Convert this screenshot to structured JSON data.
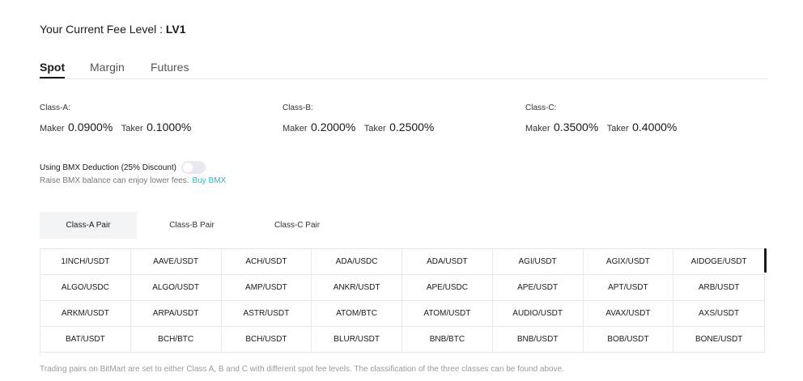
{
  "fee_level": {
    "label": "Your Current Fee Level : ",
    "level": "LV1"
  },
  "tabs": [
    {
      "label": "Spot",
      "active": true
    },
    {
      "label": "Margin",
      "active": false
    },
    {
      "label": "Futures",
      "active": false
    }
  ],
  "classes": [
    {
      "title": "Class-A:",
      "maker_label": "Maker",
      "maker": "0.0900%",
      "taker_label": "Taker",
      "taker": "0.1000%"
    },
    {
      "title": "Class-B:",
      "maker_label": "Maker",
      "maker": "0.2000%",
      "taker_label": "Taker",
      "taker": "0.2500%"
    },
    {
      "title": "Class-C:",
      "maker_label": "Maker",
      "maker": "0.3500%",
      "taker_label": "Taker",
      "taker": "0.4000%"
    }
  ],
  "bmx": {
    "label": "Using BMX Deduction (25% Discount)",
    "toggle_on": false,
    "note": "Raise BMX balance can enjoy lower fees.",
    "link": "Buy BMX"
  },
  "pair_tabs": [
    {
      "label": "Class-A Pair",
      "active": true
    },
    {
      "label": "Class-B Pair",
      "active": false
    },
    {
      "label": "Class-C Pair",
      "active": false
    }
  ],
  "pairs": [
    [
      "1INCH/USDT",
      "AAVE/USDT",
      "ACH/USDT",
      "ADA/USDC",
      "ADA/USDT",
      "AGI/USDT",
      "AGIX/USDT",
      "AIDOGE/USDT"
    ],
    [
      "ALGO/USDC",
      "ALGO/USDT",
      "AMP/USDT",
      "ANKR/USDT",
      "APE/USDC",
      "APE/USDT",
      "APT/USDT",
      "ARB/USDT"
    ],
    [
      "ARKM/USDT",
      "ARPA/USDT",
      "ASTR/USDT",
      "ATOM/BTC",
      "ATOM/USDT",
      "AUDIO/USDT",
      "AVAX/USDT",
      "AXS/USDT"
    ],
    [
      "BAT/USDT",
      "BCH/BTC",
      "BCH/USDT",
      "BLUR/USDT",
      "BNB/BTC",
      "BNB/USDT",
      "BOB/USDT",
      "BONE/USDT"
    ]
  ],
  "footer_note": "Trading pairs on BitMart are set to either Class A, B and C with different spot fee levels. The classification of the three classes can be found above."
}
